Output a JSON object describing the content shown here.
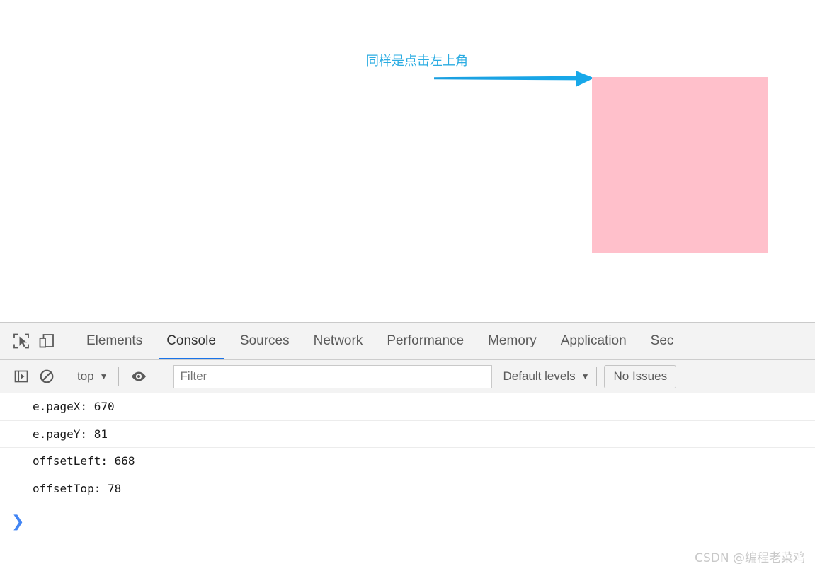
{
  "page": {
    "annotation": "同样是点击左上角",
    "annotation_color": "#2bace2",
    "arrow_color": "#1b9fe0",
    "box_color": "#ffc0cb"
  },
  "devtools": {
    "tabs": [
      {
        "label": "Elements",
        "active": false
      },
      {
        "label": "Console",
        "active": true
      },
      {
        "label": "Sources",
        "active": false
      },
      {
        "label": "Network",
        "active": false
      },
      {
        "label": "Performance",
        "active": false
      },
      {
        "label": "Memory",
        "active": false
      },
      {
        "label": "Application",
        "active": false
      },
      {
        "label": "Sec",
        "active": false
      }
    ],
    "active_tab_underline_color": "#1a73e8",
    "toolbar": {
      "inspect_icon": "inspect-element-icon",
      "device_icon": "device-toolbar-icon"
    },
    "console_toolbar": {
      "sidebar_icon": "console-sidebar-icon",
      "clear_icon": "clear-console-icon",
      "context": "top",
      "context_caret": "▼",
      "eye_icon": "live-expression-icon",
      "filter_placeholder": "Filter",
      "filter_value": "",
      "levels": "Default levels",
      "levels_caret": "▼",
      "issues": "No Issues"
    },
    "messages": [
      "e.pageX: 670",
      "e.pageY: 81",
      "offsetLeft: 668",
      "offsetTop: 78"
    ],
    "prompt_caret": "❯"
  },
  "watermark": "CSDN @编程老菜鸡"
}
